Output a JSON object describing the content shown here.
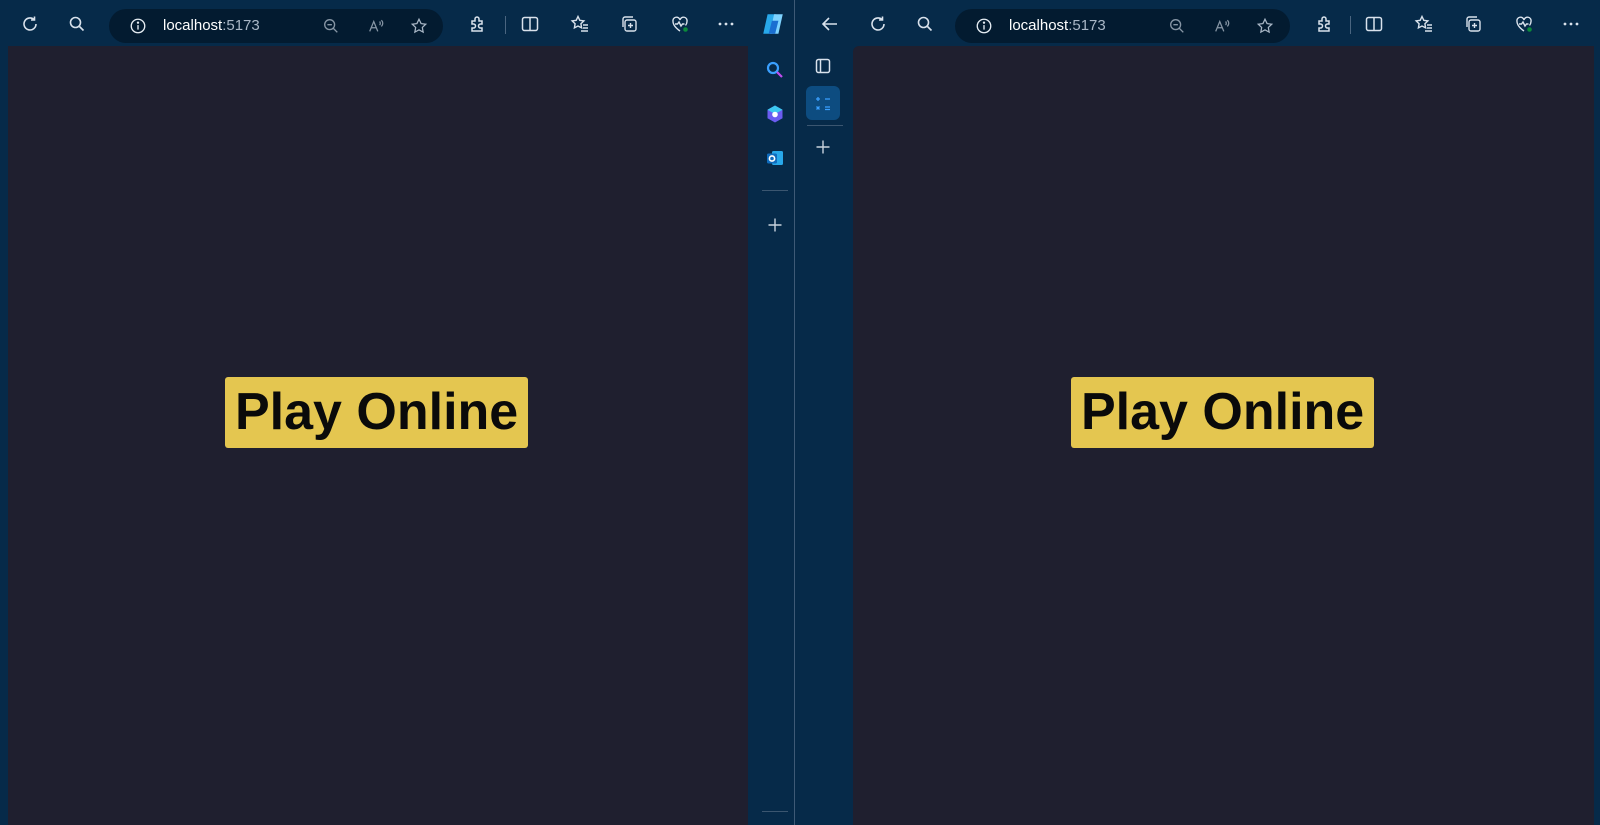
{
  "left_window": {
    "address": {
      "host": "localhost",
      "port": ":5173"
    },
    "play_button_label": "Play Online"
  },
  "right_window": {
    "address": {
      "host": "localhost",
      "port": ":5173"
    },
    "play_button_label": "Play Online"
  },
  "icons": {
    "toolbar": [
      "refresh-icon",
      "search-icon",
      "info-icon",
      "zoom-out-icon",
      "read-aloud-icon",
      "star-icon",
      "extensions-icon",
      "split-screen-icon",
      "favorites-icon",
      "collections-icon",
      "browser-essentials-icon",
      "more-icon",
      "copilot-icon"
    ],
    "sidebar": [
      "search-icon",
      "copilot-icon",
      "outlook-icon",
      "add-icon",
      "tab-actions-icon",
      "calculator-icon"
    ]
  },
  "colors": {
    "chrome": "#062a49",
    "address_bar": "#031b30",
    "page_background": "#1f1f2f",
    "play_button": "#e4c650",
    "play_button_text": "#0a0a0a"
  }
}
